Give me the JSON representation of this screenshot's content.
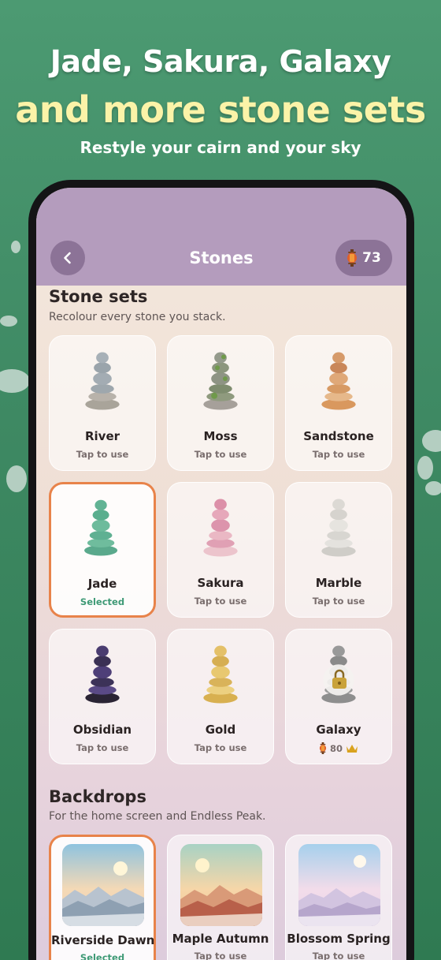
{
  "hero": {
    "line1": "Jade, Sakura, Galaxy",
    "line2": "and more stone sets",
    "subtitle": "Restyle your cairn and your sky"
  },
  "header": {
    "title": "Stones",
    "coins": "73",
    "back_icon": "chevron-left-icon",
    "coin_icon": "lantern-icon"
  },
  "stone_sets": {
    "title": "Stone sets",
    "subtitle": "Recolour every stone you stack.",
    "items": [
      {
        "name": "River",
        "status": "Tap to use"
      },
      {
        "name": "Moss",
        "status": "Tap to use"
      },
      {
        "name": "Sandstone",
        "status": "Tap to use"
      },
      {
        "name": "Jade",
        "status": "Selected"
      },
      {
        "name": "Sakura",
        "status": "Tap to use"
      },
      {
        "name": "Marble",
        "status": "Tap to use"
      },
      {
        "name": "Obsidian",
        "status": "Tap to use"
      },
      {
        "name": "Gold",
        "status": "Tap to use"
      },
      {
        "name": "Galaxy",
        "price": "80",
        "locked": true
      }
    ]
  },
  "backdrops": {
    "title": "Backdrops",
    "subtitle": "For the home screen and Endless Peak.",
    "items": [
      {
        "name": "Riverside Dawn",
        "status": "Selected"
      },
      {
        "name": "Maple Autumn",
        "status": "Tap to use"
      },
      {
        "name": "Blossom Spring",
        "status": "Tap to use"
      }
    ]
  },
  "colors": {
    "accent_selected": "#e8834a",
    "selected_text": "#3f9a76",
    "header_bg": "#b49cbd"
  }
}
